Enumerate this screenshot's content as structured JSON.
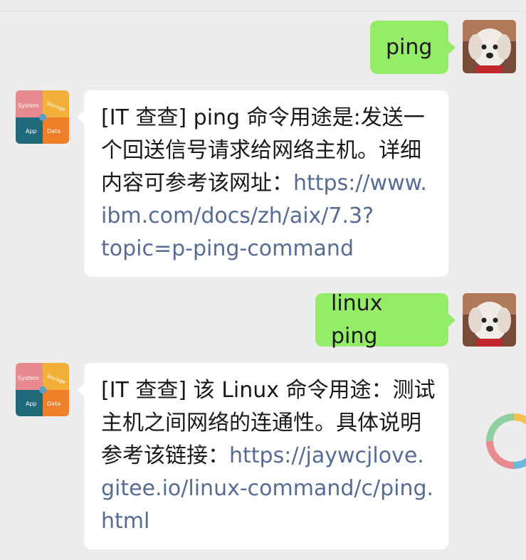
{
  "messages": [
    {
      "side": "out",
      "text": "ping"
    },
    {
      "side": "in",
      "lines": [
        {
          "text": "[IT 查查] ping 命令用途是:发送一"
        },
        {
          "text": "个回送信号请求给网络主机。详细"
        },
        {
          "text": "内容可参考该网址：",
          "link": "https://www."
        },
        {
          "link": "ibm.com/docs/zh/aix/7.3?"
        },
        {
          "link": "topic=p-ping-command"
        }
      ]
    },
    {
      "side": "out",
      "text": "linux ping"
    },
    {
      "side": "in",
      "lines": [
        {
          "text": "[IT 查查] 该 Linux 命令用途：测试"
        },
        {
          "text": "主机之间网络的连通性。具体说明"
        },
        {
          "text": "参考该链接：",
          "link": "https://jaywcjlove."
        },
        {
          "link": "gitee.io/linux-command/c/ping."
        },
        {
          "link": "html"
        }
      ]
    }
  ],
  "avatars": {
    "bot": {
      "quadrants": [
        "System",
        "Storage",
        "App",
        "Data"
      ]
    }
  },
  "colors": {
    "background": "#ededed",
    "outgoing_bubble": "#95ec69",
    "incoming_bubble": "#ffffff",
    "link": "#576b95"
  }
}
